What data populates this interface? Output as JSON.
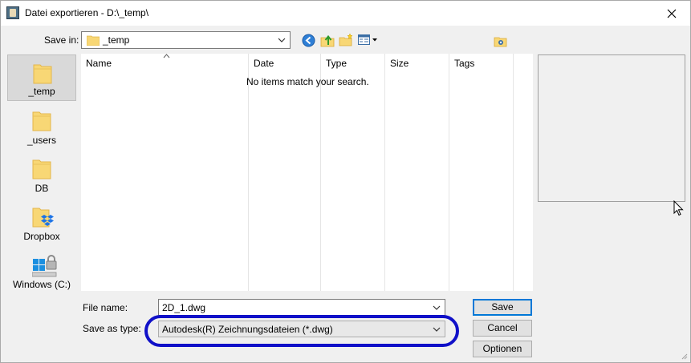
{
  "window": {
    "title": "Datei exportieren - D:\\_temp\\",
    "icons": {
      "app": "app-icon",
      "close": "close-icon"
    }
  },
  "toolbar": {
    "save_in_label": "Save in:",
    "save_in_value": "_temp",
    "icons": [
      "back-icon",
      "up-folder-icon",
      "new-folder-icon",
      "view-menu-icon",
      "extra-folder-icon"
    ]
  },
  "places": [
    {
      "label": "_temp",
      "icon": "folder-icon",
      "selected": true
    },
    {
      "label": "_users",
      "icon": "folder-icon"
    },
    {
      "label": "DB",
      "icon": "folder-icon"
    },
    {
      "label": "Dropbox",
      "icon": "dropbox-folder-icon"
    },
    {
      "label": "Windows (C:)",
      "icon": "windows-drive-icon"
    }
  ],
  "file_list": {
    "columns": [
      "Name",
      "Date",
      "Type",
      "Size",
      "Tags"
    ],
    "empty_message": "No items match your search."
  },
  "form": {
    "file_name_label": "File name:",
    "file_name_value": "2D_1.dwg",
    "save_as_type_label": "Save as type:",
    "save_as_type_value": "Autodesk(R) Zeichnungsdateien (*.dwg)"
  },
  "buttons": {
    "save": "Save",
    "cancel": "Cancel",
    "options": "Optionen"
  },
  "colors": {
    "highlight_ring": "#1010c8",
    "default_button_border": "#0078d7",
    "folder": "#f8d775"
  }
}
